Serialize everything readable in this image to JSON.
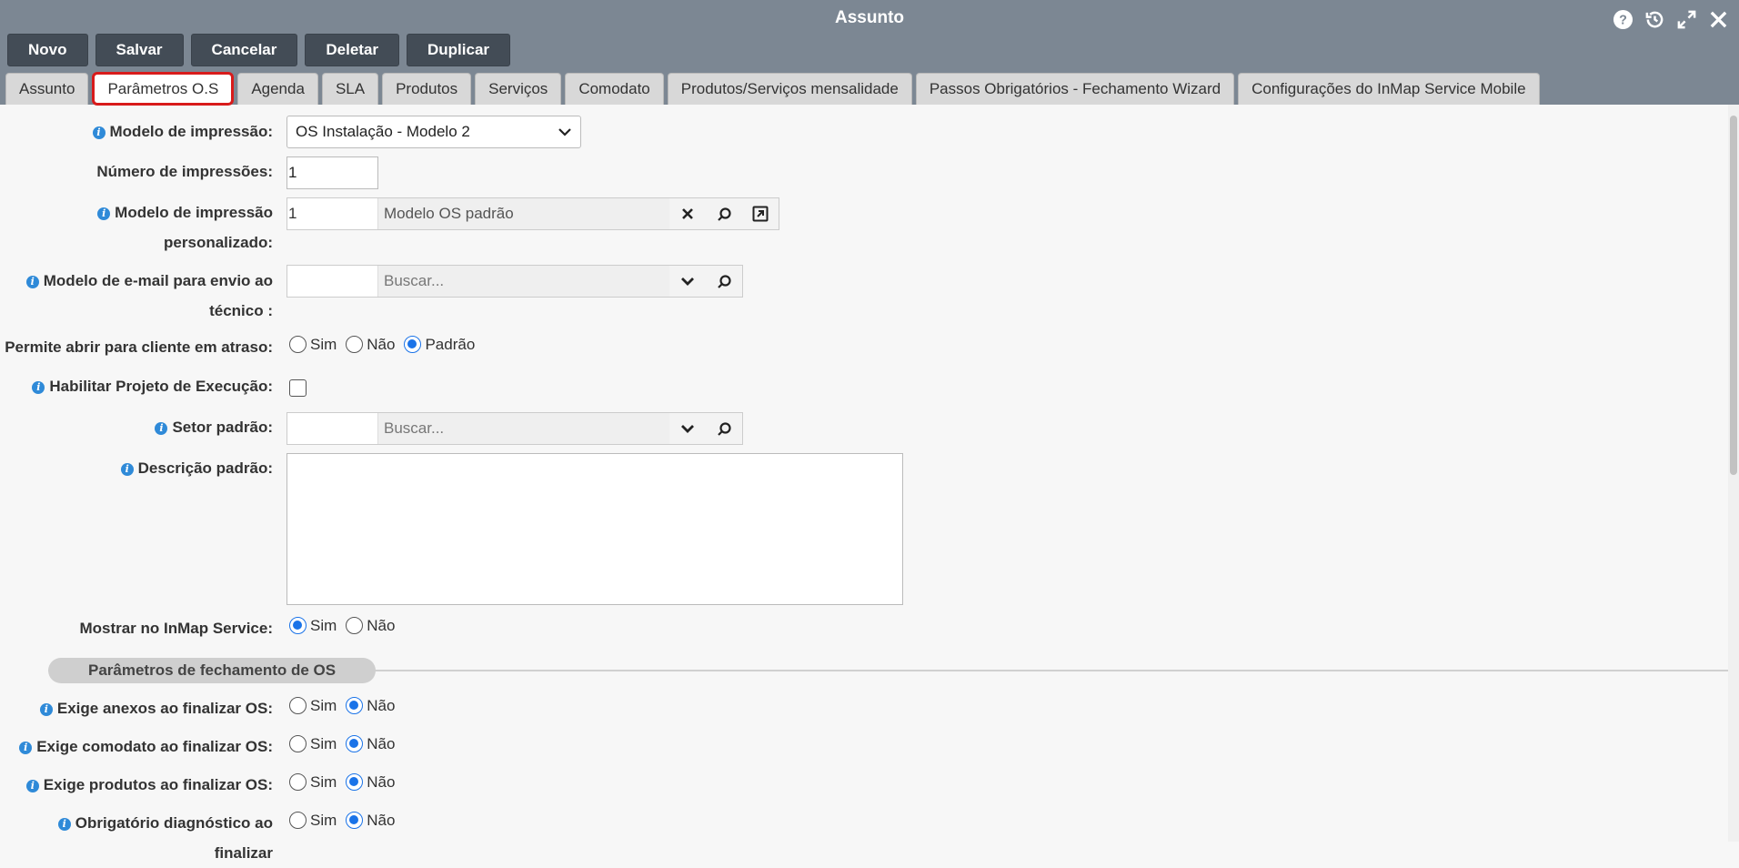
{
  "window": {
    "title": "Assunto"
  },
  "window_icons": [
    "help-icon",
    "history-icon",
    "expand-icon",
    "close-icon"
  ],
  "toolbar": {
    "novo": "Novo",
    "salvar": "Salvar",
    "cancelar": "Cancelar",
    "deletar": "Deletar",
    "duplicar": "Duplicar"
  },
  "tabs": [
    {
      "label": "Assunto",
      "active": false
    },
    {
      "label": "Parâmetros O.S",
      "active": true
    },
    {
      "label": "Agenda",
      "active": false
    },
    {
      "label": "SLA",
      "active": false
    },
    {
      "label": "Produtos",
      "active": false
    },
    {
      "label": "Serviços",
      "active": false
    },
    {
      "label": "Comodato",
      "active": false
    },
    {
      "label": "Produtos/Serviços mensalidade",
      "active": false
    },
    {
      "label": "Passos Obrigatórios - Fechamento Wizard",
      "active": false
    },
    {
      "label": "Configurações do InMap Service Mobile",
      "active": false
    }
  ],
  "form": {
    "modelo_impressao": {
      "label": "Modelo de impressão:",
      "value": "OS Instalação - Modelo 2"
    },
    "numero_impressoes": {
      "label": "Número de impressões:",
      "value": "1"
    },
    "modelo_personalizado": {
      "label_line1": "Modelo de impressão",
      "label_line2": "personalizado:",
      "code": "1",
      "description": "Modelo OS padrão"
    },
    "modelo_email": {
      "label_line1": "Modelo de e-mail para envio ao",
      "label_line2": "técnico :",
      "code": "",
      "placeholder": "Buscar..."
    },
    "permite_atraso": {
      "label": "Permite abrir para cliente em atraso:",
      "options": [
        "Sim",
        "Não",
        "Padrão"
      ],
      "selected": "Padrão"
    },
    "projeto_execucao": {
      "label": "Habilitar Projeto de Execução:",
      "checked": false
    },
    "setor_padrao": {
      "label": "Setor padrão:",
      "code": "",
      "placeholder": "Buscar..."
    },
    "descricao_padrao": {
      "label": "Descrição padrão:",
      "value": ""
    },
    "mostrar_inmap": {
      "label": "Mostrar no InMap Service:",
      "options": [
        "Sim",
        "Não"
      ],
      "selected": "Sim"
    }
  },
  "section": {
    "title": "Parâmetros de fechamento de OS"
  },
  "fechamento": [
    {
      "label": "Exige anexos ao finalizar OS:",
      "options": [
        "Sim",
        "Não"
      ],
      "selected": "Não"
    },
    {
      "label": "Exige comodato ao finalizar OS:",
      "options": [
        "Sim",
        "Não"
      ],
      "selected": "Não"
    },
    {
      "label": "Exige produtos ao finalizar OS:",
      "options": [
        "Sim",
        "Não"
      ],
      "selected": "Não"
    },
    {
      "label": "Obrigatório diagnóstico ao finalizar",
      "options": [
        "Sim",
        "Não"
      ],
      "selected": "Não"
    }
  ]
}
